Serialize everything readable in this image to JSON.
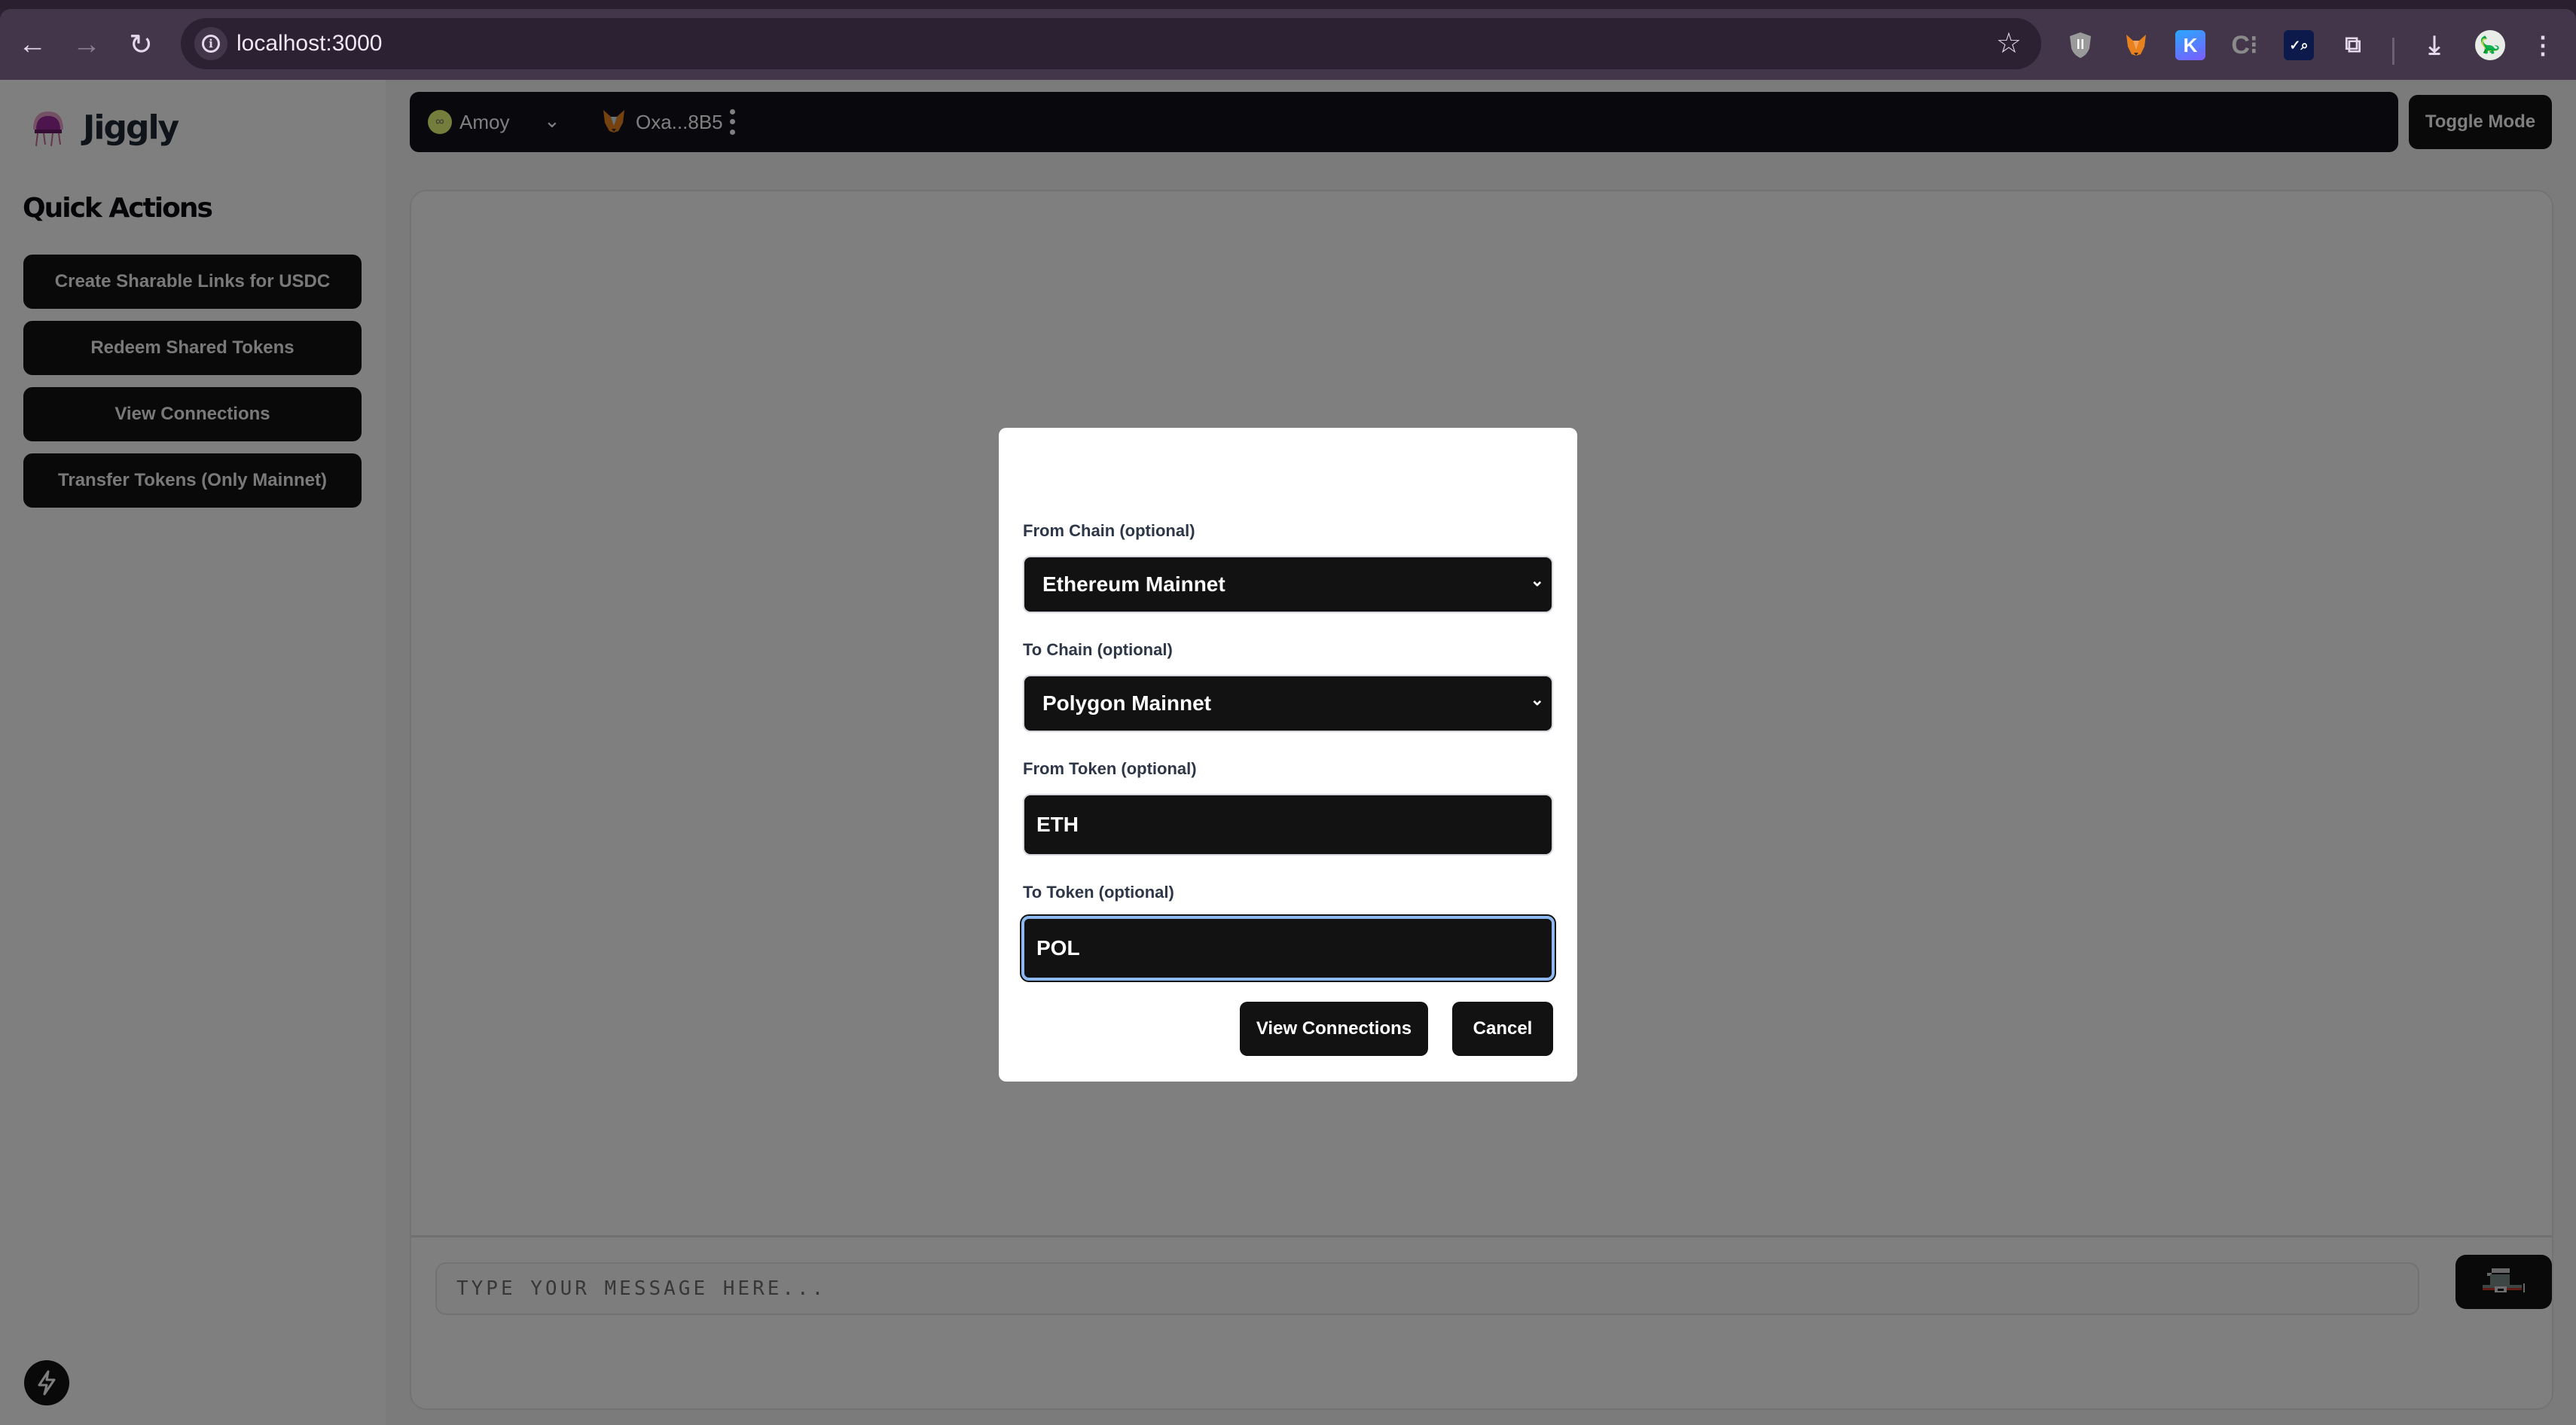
{
  "browser": {
    "url": "localhost:3000",
    "nav": {
      "back_icon": "arrow-left-icon",
      "forward_icon": "arrow-right-icon",
      "reload_icon": "reload-icon"
    },
    "extensions": [
      {
        "name": "privacy-shield-extension",
        "glyph": "II",
        "color": "#9a9a9a"
      },
      {
        "name": "metamask-extension",
        "glyph": "🦊",
        "color": "#e8821e"
      },
      {
        "name": "k-extension",
        "glyph": "K",
        "color": "#3b82f6"
      },
      {
        "name": "c-extension",
        "glyph": "C⁚",
        "color": "#8a8a8a"
      },
      {
        "name": "chart-extension",
        "glyph": "√",
        "color": "#0b1a4a"
      },
      {
        "name": "extensions-puzzle",
        "glyph": "⧉",
        "color": "#e4d8ea"
      }
    ]
  },
  "sidebar": {
    "brand": "Jiggly",
    "quick_actions_title": "Quick Actions",
    "actions": [
      {
        "label": "Create Sharable Links for USDC"
      },
      {
        "label": "Redeem Shared Tokens"
      },
      {
        "label": "View Connections"
      },
      {
        "label": "Transfer Tokens (Only Mainnet)"
      }
    ]
  },
  "topbar": {
    "network": "Amoy",
    "wallet_address": "Oxa...8B5",
    "toggle_mode_label": "Toggle Mode"
  },
  "chat": {
    "placeholder": "TYPE YOUR MESSAGE HERE..."
  },
  "modal": {
    "from_chain_label": "From Chain (optional)",
    "from_chain_value": "Ethereum Mainnet",
    "to_chain_label": "To Chain (optional)",
    "to_chain_value": "Polygon Mainnet",
    "from_token_label": "From Token (optional)",
    "from_token_value": "ETH",
    "to_token_label": "To Token (optional)",
    "to_token_value": "POL",
    "submit_label": "View Connections",
    "cancel_label": "Cancel"
  }
}
